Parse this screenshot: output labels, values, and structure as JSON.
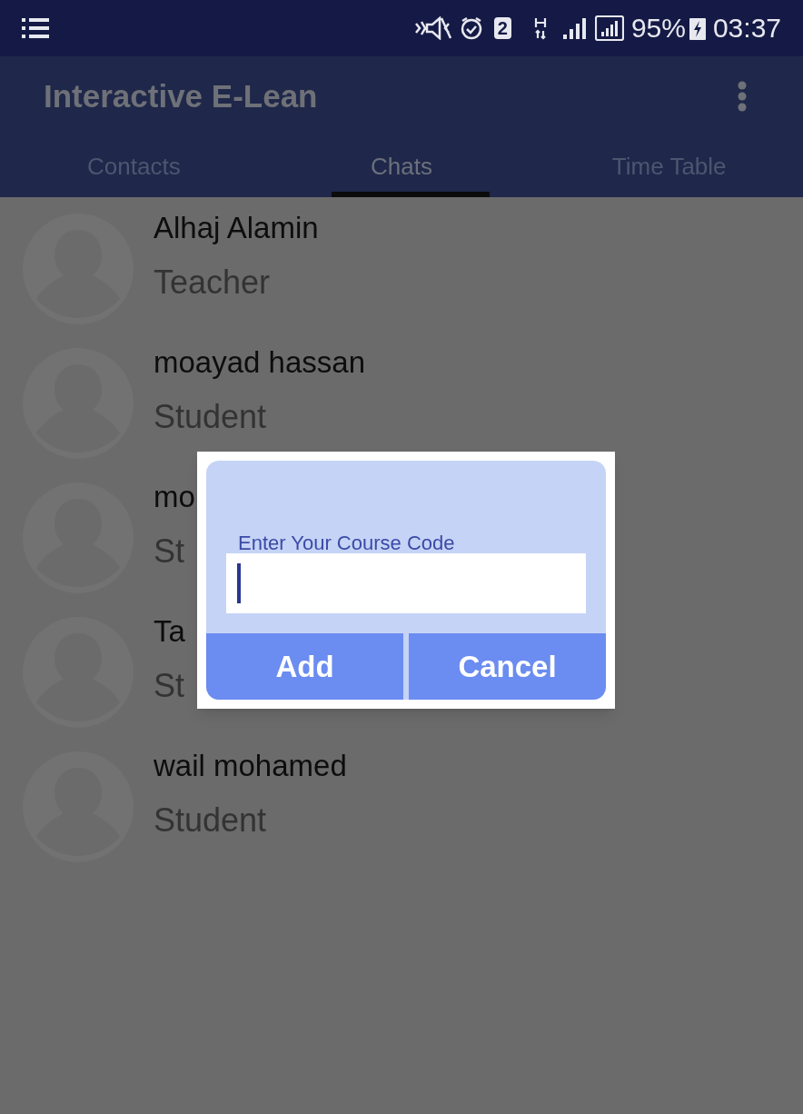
{
  "status_bar": {
    "sim_badge": "2",
    "battery": "95%",
    "time": "03:37"
  },
  "app_bar": {
    "title": "Interactive E-Lean"
  },
  "tabs": [
    {
      "label": "Contacts",
      "selected": false
    },
    {
      "label": "Chats",
      "selected": true
    },
    {
      "label": "Time Table",
      "selected": false
    }
  ],
  "chats": [
    {
      "name": "Alhaj Alamin",
      "role": "Teacher"
    },
    {
      "name": "moayad hassan",
      "role": "Student"
    },
    {
      "name": "mo",
      "role": "St"
    },
    {
      "name": "Ta",
      "role": "St"
    },
    {
      "name": "wail mohamed",
      "role": "Student"
    }
  ],
  "dialog": {
    "field": {
      "label": "Enter Your Course Code"
    },
    "buttons": [
      "Add",
      "Cancel"
    ]
  }
}
